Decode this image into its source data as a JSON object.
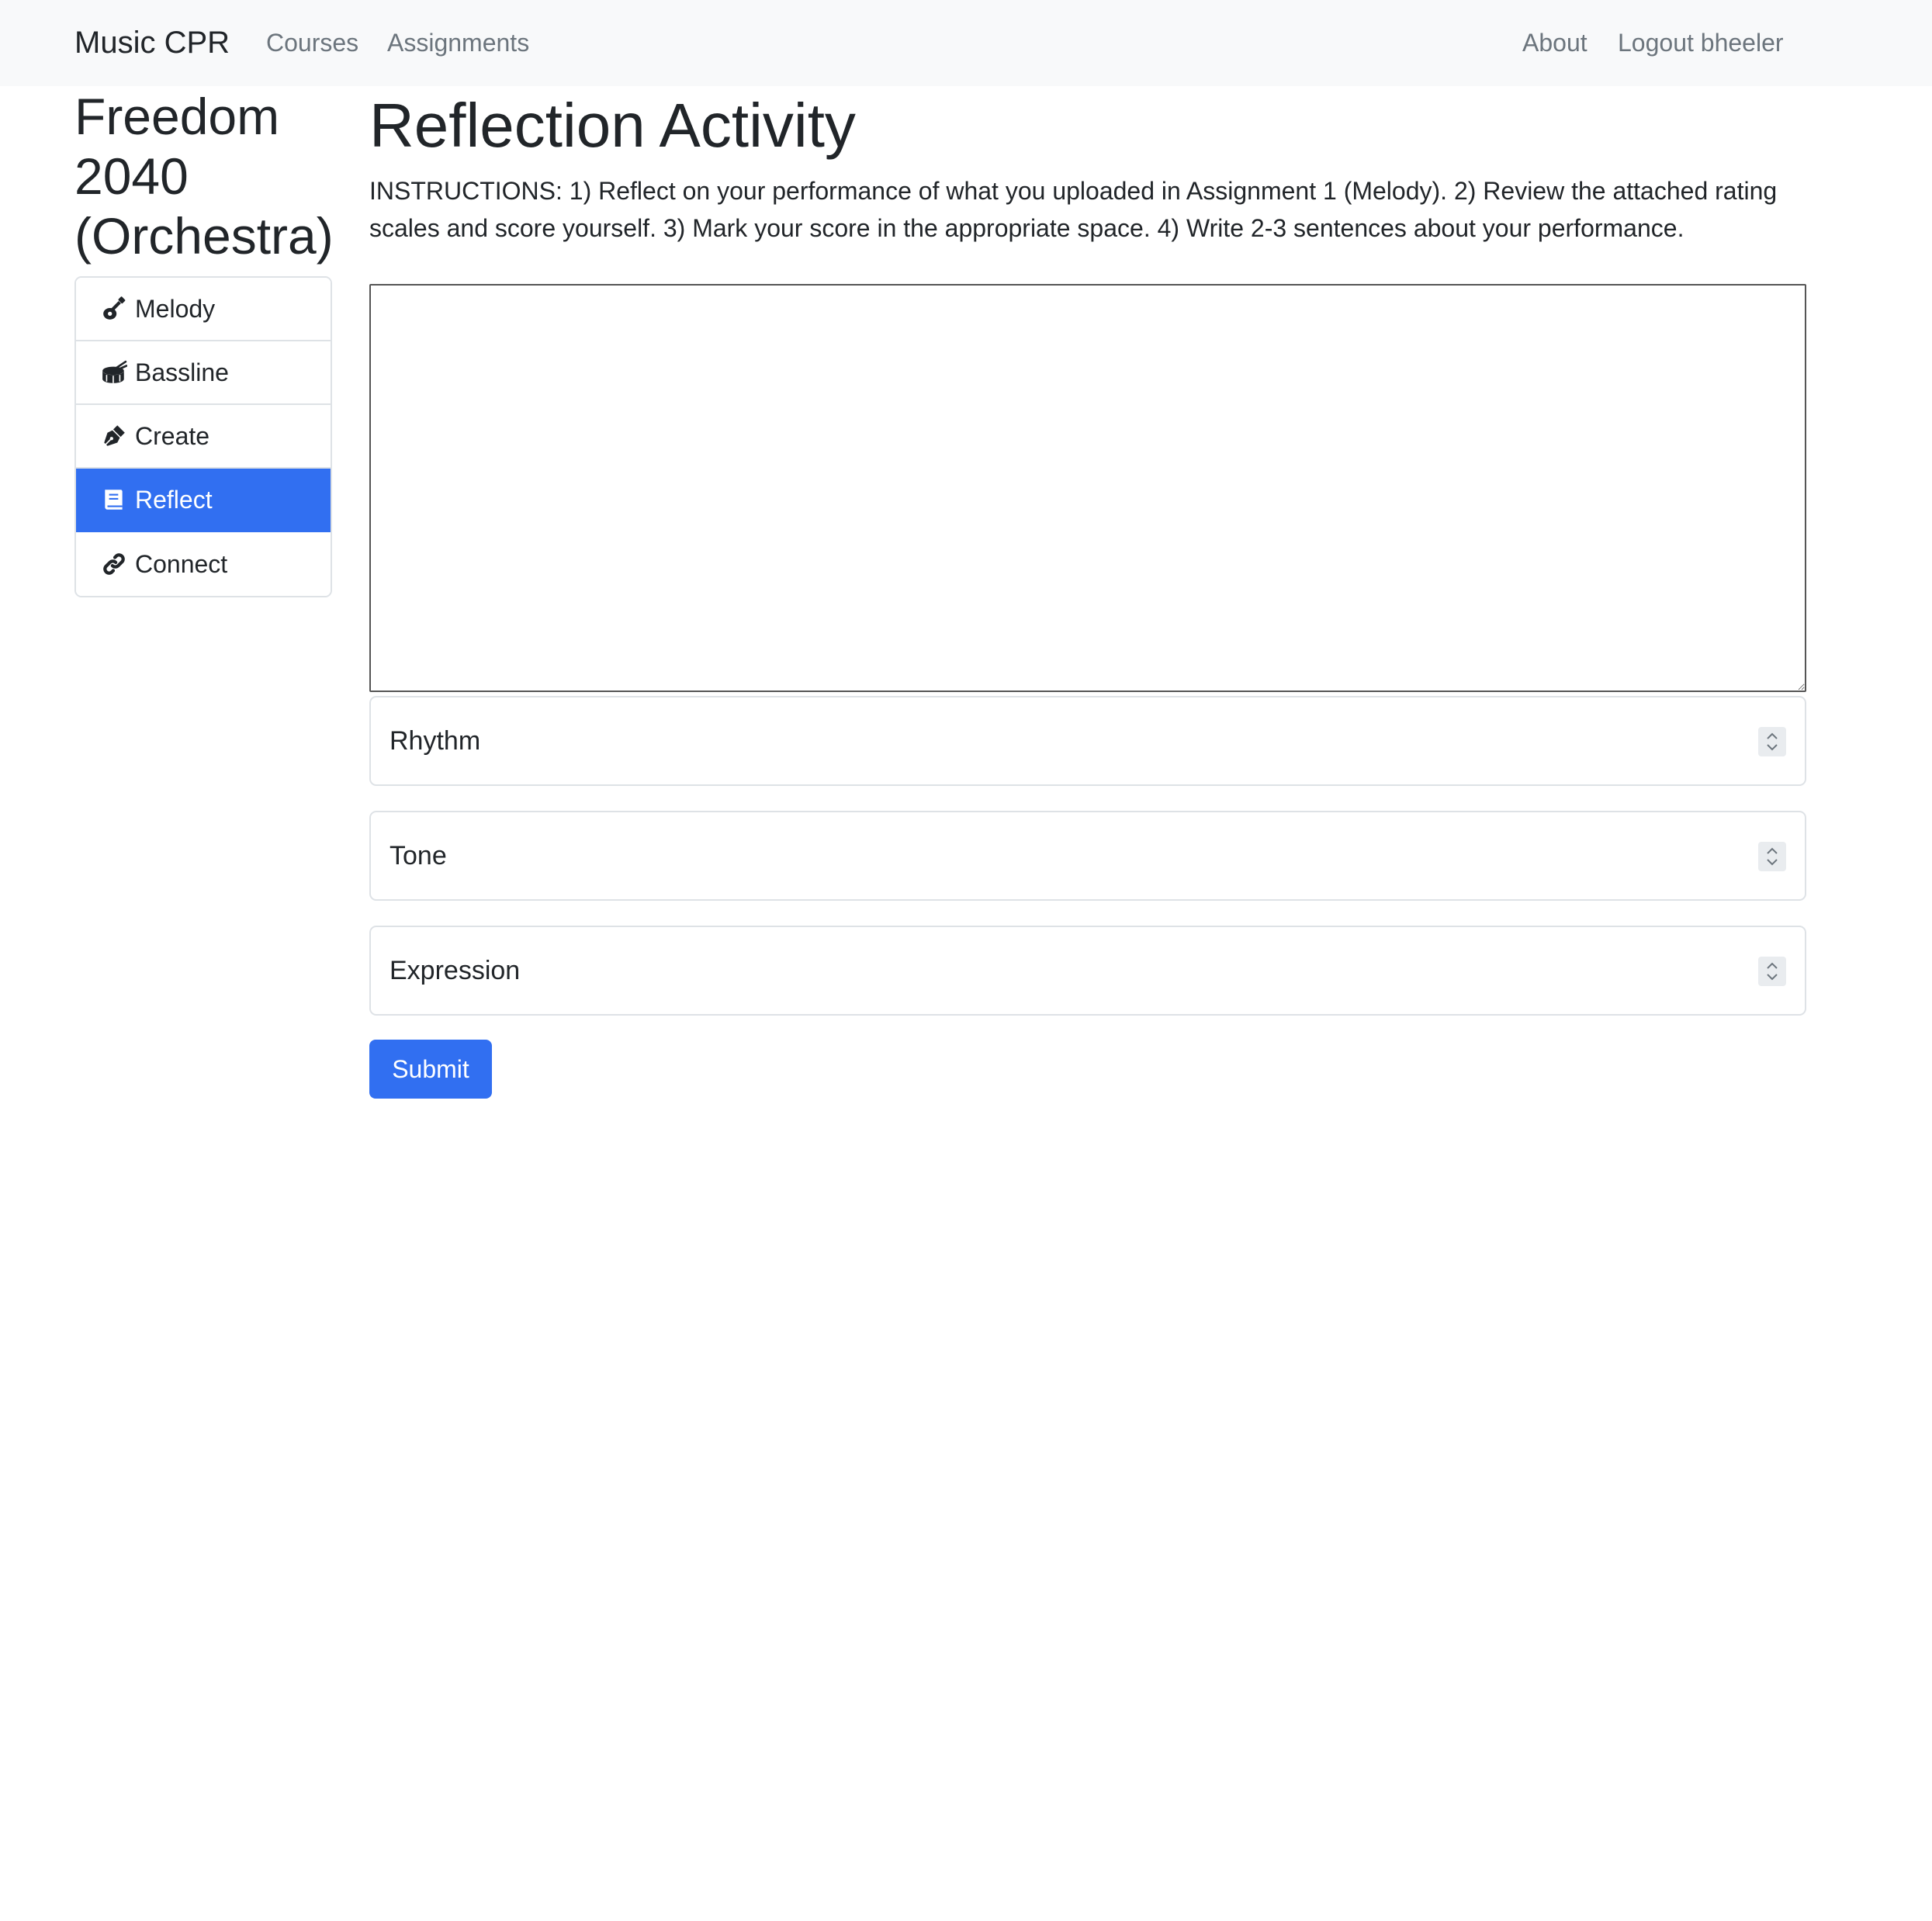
{
  "navbar": {
    "brand": "Music CPR",
    "links": [
      "Courses",
      "Assignments"
    ],
    "right_links": [
      "About",
      "Logout bheeler"
    ]
  },
  "sidebar": {
    "heading": "Freedom 2040 (Orchestra)",
    "items": [
      {
        "label": "Melody",
        "icon": "guitar-icon"
      },
      {
        "label": "Bassline",
        "icon": "drum-icon"
      },
      {
        "label": "Create",
        "icon": "pen-nib-icon"
      },
      {
        "label": "Reflect",
        "icon": "book-icon",
        "active": true
      },
      {
        "label": "Connect",
        "icon": "link-icon"
      }
    ]
  },
  "main": {
    "title": "Reflection Activity",
    "instructions": "INSTRUCTIONS: 1) Reflect on your performance of what you uploaded in Assignment 1 (Melody). 2) Review the attached rating scales and score yourself. 3) Mark your score in the appropriate space. 4) Write 2-3 sentences about your performance.",
    "textarea_value": "",
    "fields": [
      {
        "placeholder": "Rhythm",
        "value": ""
      },
      {
        "placeholder": "Tone",
        "value": ""
      },
      {
        "placeholder": "Expression",
        "value": ""
      }
    ],
    "submit_label": "Submit"
  },
  "colors": {
    "accent": "#316ff1",
    "navbar_bg": "#f8f9fa",
    "muted_text": "#6c757d"
  }
}
